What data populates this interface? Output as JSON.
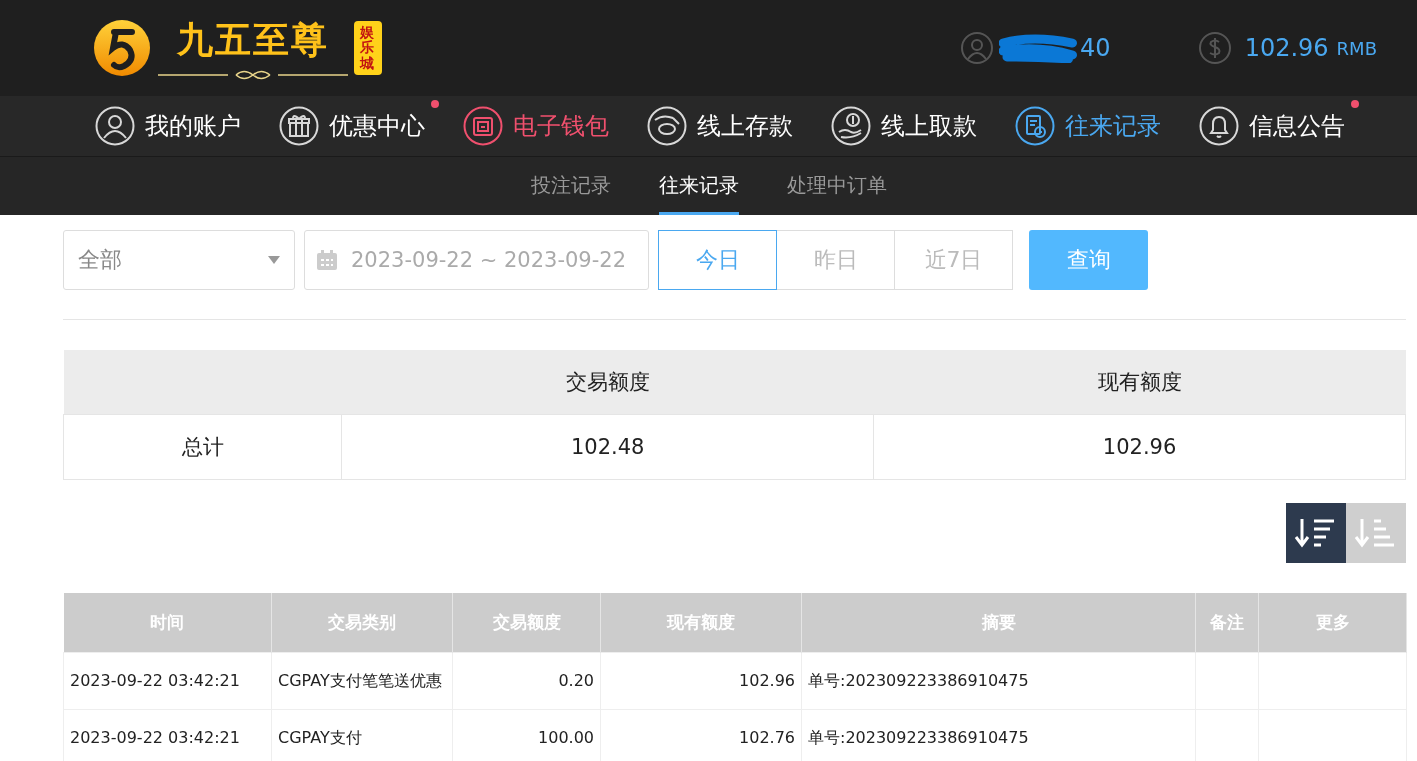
{
  "header": {
    "logo": {
      "title": "九五至尊",
      "badge": "娱乐城"
    },
    "user": {
      "name": "40"
    },
    "balance": {
      "amount": "102.96",
      "currency": "RMB"
    }
  },
  "nav": [
    {
      "label": "我的账户",
      "kind": "user",
      "selected": false,
      "highlighted": false,
      "dot": false
    },
    {
      "label": "优惠中心",
      "kind": "gift",
      "selected": false,
      "highlighted": false,
      "dot": true
    },
    {
      "label": "电子钱包",
      "kind": "wallet",
      "selected": false,
      "highlighted": true,
      "dot": false
    },
    {
      "label": "线上存款",
      "kind": "deposit",
      "selected": false,
      "highlighted": false,
      "dot": false
    },
    {
      "label": "线上取款",
      "kind": "withdraw",
      "selected": false,
      "highlighted": false,
      "dot": false
    },
    {
      "label": "往来记录",
      "kind": "records",
      "selected": true,
      "highlighted": false,
      "dot": false
    },
    {
      "label": "信息公告",
      "kind": "bell",
      "selected": false,
      "highlighted": false,
      "dot": true
    }
  ],
  "subtabs": [
    {
      "label": "投注记录",
      "selected": false
    },
    {
      "label": "往来记录",
      "selected": true
    },
    {
      "label": "处理中订单",
      "selected": false
    }
  ],
  "filters": {
    "type_select": {
      "value": "全部"
    },
    "date_range": {
      "value": "2023-09-22 ~ 2023-09-22"
    },
    "quick_ranges": [
      {
        "label": "今日",
        "selected": true
      },
      {
        "label": "昨日",
        "selected": false
      },
      {
        "label": "近7日",
        "selected": false
      }
    ],
    "query_button": "查询"
  },
  "summary": {
    "columns": [
      "交易额度",
      "现有额度"
    ],
    "rows": [
      {
        "label": "总计",
        "values": [
          "102.48",
          "102.96"
        ]
      }
    ]
  },
  "sort_buttons": [
    {
      "kind": "desc",
      "selected": true
    },
    {
      "kind": "asc",
      "selected": false
    }
  ],
  "table": {
    "columns": [
      "时间",
      "交易类别",
      "交易额度",
      "现有额度",
      "摘要",
      "备注",
      "更多"
    ],
    "rows": [
      [
        "2023-09-22 03:42:21",
        "CGPAY支付笔笔送优惠",
        "0.20",
        "102.96",
        "单号:202309223386910475",
        "",
        ""
      ],
      [
        "2023-09-22 03:42:21",
        "CGPAY支付",
        "100.00",
        "102.76",
        "单号:202309223386910475",
        "",
        ""
      ]
    ]
  }
}
